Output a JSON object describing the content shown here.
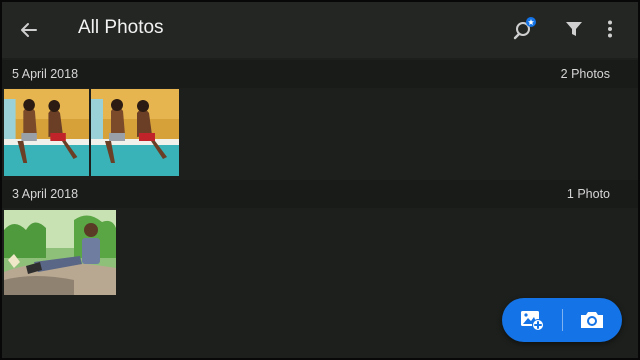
{
  "header": {
    "title": "All Photos",
    "icons": [
      "back-arrow-icon",
      "search-sparkle-icon",
      "filter-icon",
      "more-vertical-icon"
    ]
  },
  "sections": [
    {
      "date": "5 April 2018",
      "count": "2 Photos",
      "photos": [
        {
          "description": "two-people-by-pool"
        },
        {
          "description": "two-people-by-pool"
        }
      ]
    },
    {
      "date": "3 April 2018",
      "count": "1 Photo",
      "photos": [
        {
          "description": "man-on-rock-among-plants"
        }
      ]
    }
  ],
  "fab": {
    "icons": [
      "add-photo-icon",
      "camera-icon"
    ],
    "accent": "#1473e6"
  },
  "colors": {
    "background": "#1c1f1c",
    "appbar": "#232623",
    "section_header": "#191b19",
    "text": "#f2f2f2"
  }
}
